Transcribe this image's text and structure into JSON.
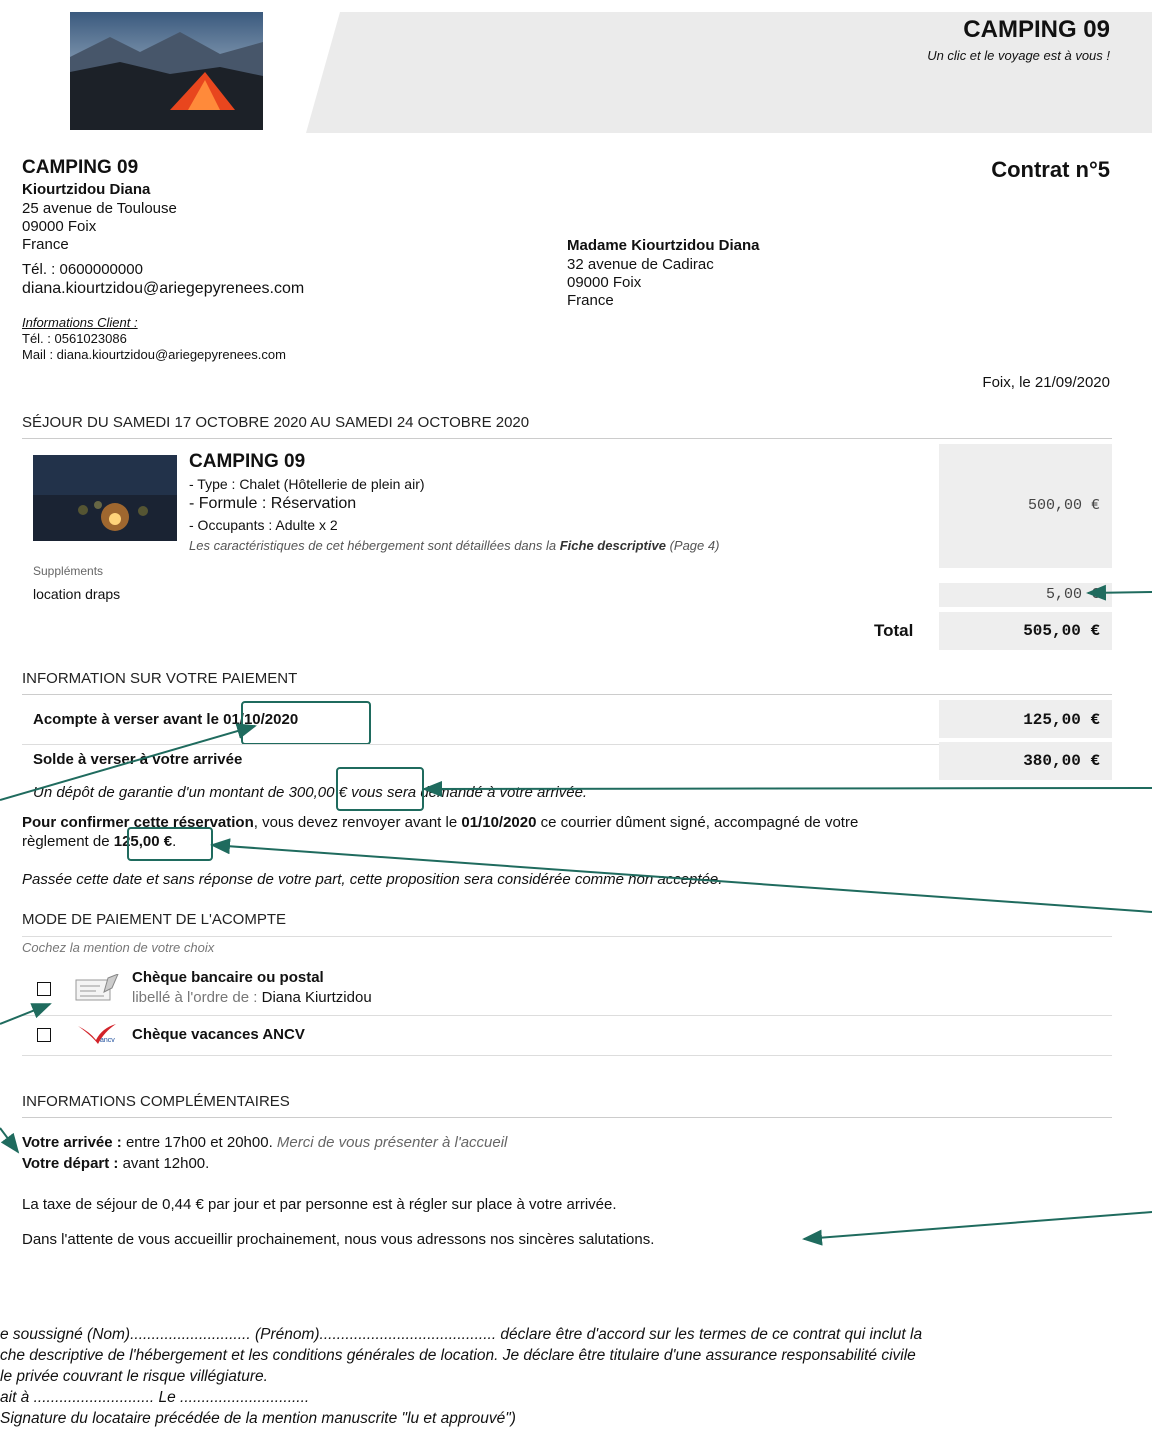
{
  "header": {
    "brand": "CAMPING 09",
    "slogan": "Un clic et le voyage est à vous !"
  },
  "sender": {
    "name": "CAMPING 09",
    "contact": "Kiourtzidou Diana",
    "street": "25 avenue de Toulouse",
    "city": "09000 Foix",
    "country": "France",
    "tel": "Tél. : 0600000000",
    "email": "diana.kiourtzidou@ariegepyrenees.com"
  },
  "client_info": {
    "title": "Informations Client :",
    "tel": "Tél. : 0561023086",
    "mail": "Mail : diana.kiourtzidou@ariegepyrenees.com"
  },
  "recipient": {
    "name": "Madame Kiourtzidou Diana",
    "street": "32 avenue de Cadirac",
    "city": "09000 Foix",
    "country": "France"
  },
  "contract": {
    "title": "Contrat n°5",
    "place_date": "Foix, le 21/09/2020"
  },
  "stay": {
    "title": "SÉJOUR DU SAMEDI 17 OCTOBRE 2020 AU SAMEDI 24 OCTOBRE 2020",
    "name": "CAMPING 09",
    "type": "- Type : Chalet (Hôtellerie de plein air)",
    "formule": "- Formule : Réservation",
    "occupants": "- Occupants :  Adulte x 2",
    "note_pre": "Les caractéristiques de cet hébergement sont détaillées dans la ",
    "note_bold": "Fiche descriptive",
    "note_post": " (Page 4)",
    "price": "500,00 €",
    "supplements_label": "Suppléments",
    "supplement_item": "location draps",
    "supplement_price": "5,00 €",
    "total_label": "Total",
    "total": "505,00 €"
  },
  "payment": {
    "title": "INFORMATION SUR VOTRE PAIEMENT",
    "deposit_label_a": "Acompte à verser avant ",
    "deposit_label_b": "le 01/10/2020",
    "deposit_amount": "125,00 €",
    "balance_label": "Solde à verser à votre arrivée",
    "balance_amount": "380,00 €",
    "guarantee_a": "Un dépôt de garantie d'un montant de ",
    "guarantee_b": "300,00 €",
    "guarantee_c": " vous sera demandé à votre arrivée.",
    "confirm_a": "Pour confirmer cette réservation",
    "confirm_b": ", vous devez renvoyer avant le ",
    "confirm_c": "01/10/2020",
    "confirm_d": " ce courrier dûment signé, accompagné de votre",
    "confirm_e": "règlement de ",
    "confirm_f": "125,00 €",
    "confirm_g": ".",
    "expiry": "Passée cette date et sans réponse de votre part, cette proposition sera considérée comme non acceptée."
  },
  "mode": {
    "title": "MODE DE PAIEMENT DE L'ACOMPTE",
    "hint": "Cochez la mention de votre choix",
    "opt1": "Chèque bancaire ou postal",
    "opt1_sub_a": "libellé à l'ordre de : ",
    "opt1_sub_b": "Diana Kiurtzidou",
    "opt2": "Chèque vacances ANCV",
    "ancv_text": "ancv"
  },
  "extra": {
    "title": "INFORMATIONS COMPLÉMENTAIRES",
    "arrival_label": "Votre arrivée : ",
    "arrival_text": "entre 17h00 et 20h00. ",
    "arrival_note": "Merci de vous présenter à l'accueil",
    "departure_label": "Votre départ : ",
    "departure_text": "avant 12h00.",
    "tax": "La taxe de séjour de 0,44 € par jour et par personne est à régler sur place à votre arrivée.",
    "closing": "Dans l'attente de vous accueillir prochainement, nous vous adressons nos sincères salutations."
  },
  "signature": {
    "line1": "e soussigné (Nom)............................ (Prénom)......................................... déclare être d'accord sur les termes de ce contrat qui inclut la",
    "line2": "che descriptive de l'hébergement et les conditions générales de location. Je déclare être titulaire d'une assurance responsabilité civile",
    "line3": "le privée couvrant le risque villégiature.",
    "line4": "ait à ............................ Le ..............................",
    "line5": "Signature du locataire précédée de la mention manuscrite \"lu et approuvé\")"
  },
  "colors": {
    "accent": "#1f6b5e",
    "panel": "#eeeeee",
    "header": "#ebebeb"
  }
}
